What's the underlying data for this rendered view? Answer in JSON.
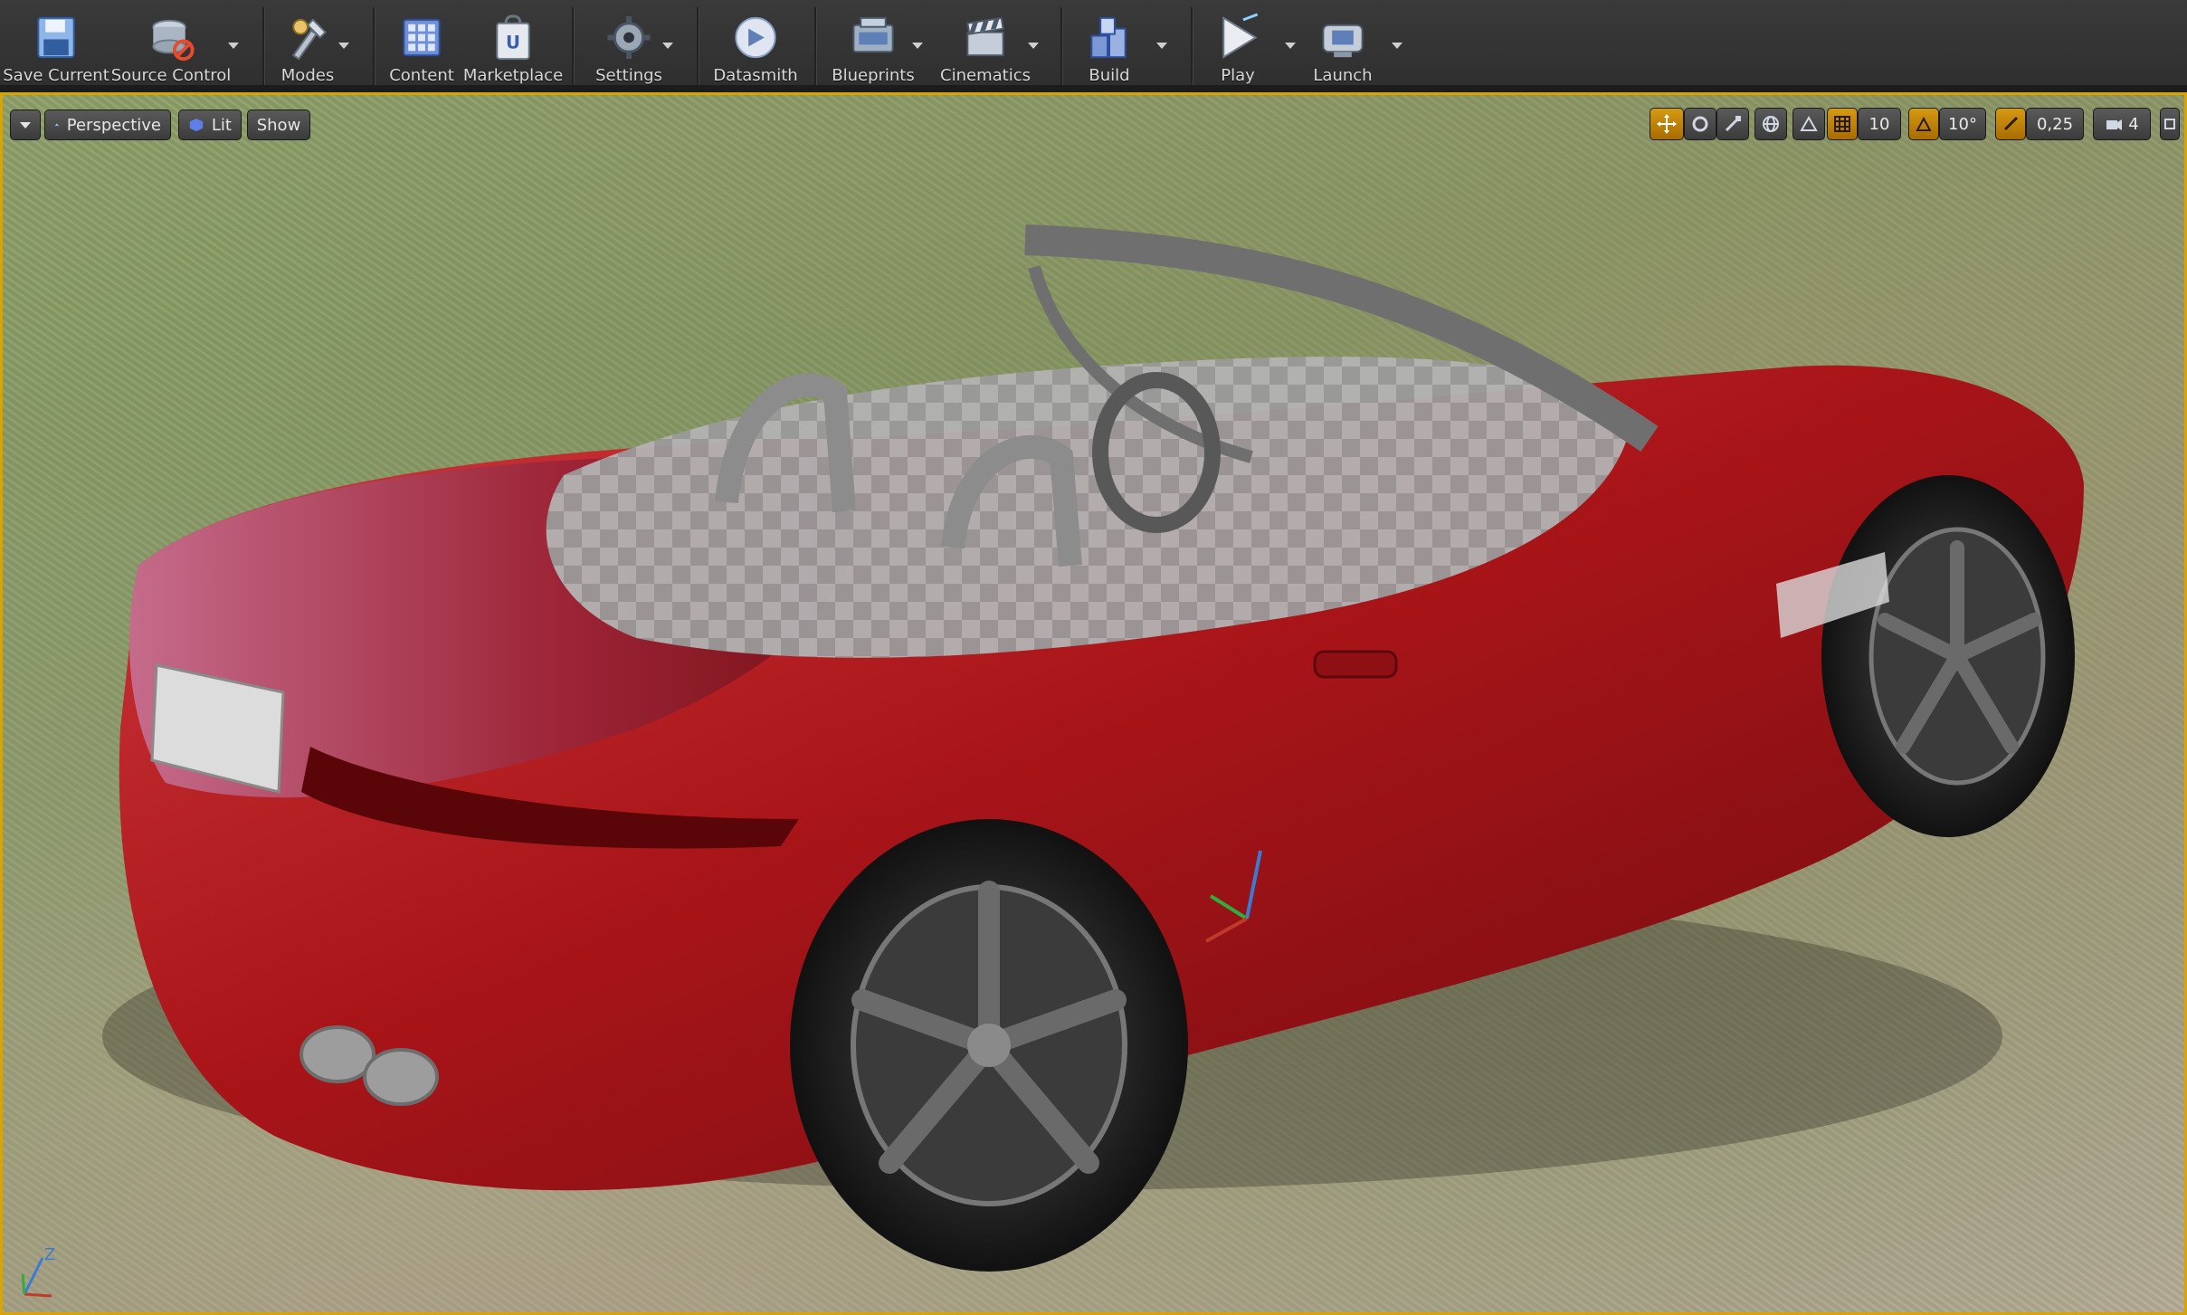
{
  "toolbar": {
    "save_current": "Save Current",
    "source_control": "Source Control",
    "modes": "Modes",
    "content": "Content",
    "marketplace": "Marketplace",
    "settings": "Settings",
    "datasmith": "Datasmith",
    "blueprints": "Blueprints",
    "cinematics": "Cinematics",
    "build": "Build",
    "play": "Play",
    "launch": "Launch"
  },
  "viewport": {
    "view_mode": "Perspective",
    "lighting_mode": "Lit",
    "show_label": "Show",
    "grid_snap_value": "10",
    "rotation_snap_value": "10°",
    "scale_snap_value": "0,25",
    "camera_speed_value": "4",
    "axis_z_label": "Z"
  },
  "colors": {
    "accent": "#d9a400",
    "car_paint": "#b3141b",
    "toolbar_bg": "#333333"
  }
}
